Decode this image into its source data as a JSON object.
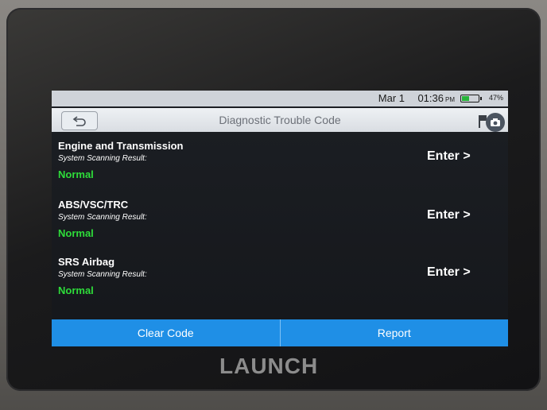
{
  "status_bar": {
    "date": "Mar 1",
    "time": "01:36",
    "ampm": "PM",
    "battery": "47%",
    "battery_level": 0.47
  },
  "header": {
    "title": "Diagnostic Trouble Code"
  },
  "results": [
    {
      "system": "Engine and Transmission",
      "scan_label": "System Scanning Result:",
      "status": "Normal",
      "action": "Enter >"
    },
    {
      "system": "ABS/VSC/TRC",
      "scan_label": "System Scanning Result:",
      "status": "Normal",
      "action": "Enter >"
    },
    {
      "system": "SRS Airbag",
      "scan_label": "System Scanning Result:",
      "status": "Normal",
      "action": "Enter >"
    }
  ],
  "footer": {
    "clear_label": "Clear Code",
    "report_label": "Report"
  },
  "brand": "LAUNCH",
  "colors": {
    "accent": "#1f8fe6",
    "normal_status": "#2edc3a"
  },
  "icons": {
    "back": "back-arrow-icon",
    "flag": "flag-icon",
    "camera": "camera-icon"
  }
}
